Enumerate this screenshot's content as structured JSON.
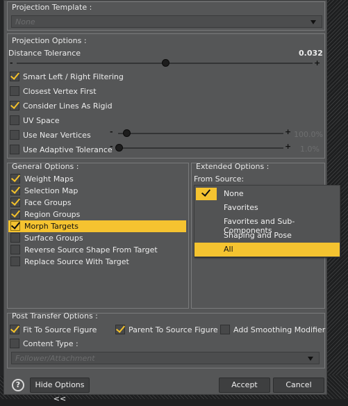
{
  "projection_template": {
    "label": "Projection Template :",
    "value": "None"
  },
  "projection_options": {
    "title": "Projection Options :",
    "distance_tolerance": {
      "label": "Distance Tolerance",
      "value": "0.032",
      "minus": "-",
      "plus": "+",
      "level": 0.5
    },
    "checks": [
      {
        "label": "Smart Left / Right Filtering",
        "checked": true
      },
      {
        "label": "Closest Vertex First",
        "checked": false
      },
      {
        "label": "Consider Lines As Rigid",
        "checked": true
      },
      {
        "label": "UV Space",
        "checked": false
      },
      {
        "label": "Use Near Vertices",
        "checked": false
      },
      {
        "label": "Use Adaptive Tolerance",
        "checked": false
      }
    ],
    "near_vertices_slider": {
      "minus": "-",
      "plus": "+",
      "value": "100.0%",
      "level": 0.05
    },
    "adaptive_slider": {
      "minus": "-",
      "plus": "+",
      "value": "1.0%",
      "level": 0.0
    }
  },
  "general_options": {
    "title": "General Options :",
    "items": [
      {
        "label": "Weight Maps",
        "checked": true
      },
      {
        "label": "Selection Map",
        "checked": true
      },
      {
        "label": "Face Groups",
        "checked": true
      },
      {
        "label": "Region Groups",
        "checked": true
      },
      {
        "label": "Morph Targets",
        "checked": true
      },
      {
        "label": "Surface Groups",
        "checked": false
      },
      {
        "label": "Reverse Source Shape From Target",
        "checked": false
      },
      {
        "label": "Replace Source With Target",
        "checked": false
      }
    ]
  },
  "extended_options": {
    "title": "Extended Options :",
    "from_source": "From Source:",
    "dropdown_items": [
      {
        "label": "None",
        "checked": true
      },
      {
        "label": "Favorites"
      },
      {
        "label": "Favorites and Sub-Components"
      },
      {
        "label": "Shaping and Pose"
      },
      {
        "label": "All",
        "selected": true
      }
    ]
  },
  "post_transfer": {
    "title": "Post Transfer Options :",
    "fit_to_source": {
      "label": "Fit To Source Figure",
      "checked": true
    },
    "parent_to_source": {
      "label": "Parent To Source Figure",
      "checked": true
    },
    "add_smoothing": {
      "label": "Add Smoothing Modifier",
      "checked": false
    },
    "content_type": {
      "label": "Content Type :",
      "checked": false
    },
    "content_value": "Follower/Attachment"
  },
  "footer": {
    "help": "?",
    "hide_options": "Hide Options <<",
    "accept": "Accept",
    "cancel": "Cancel"
  },
  "colors": {
    "accent": "#f5c330",
    "panel": "#555657"
  }
}
